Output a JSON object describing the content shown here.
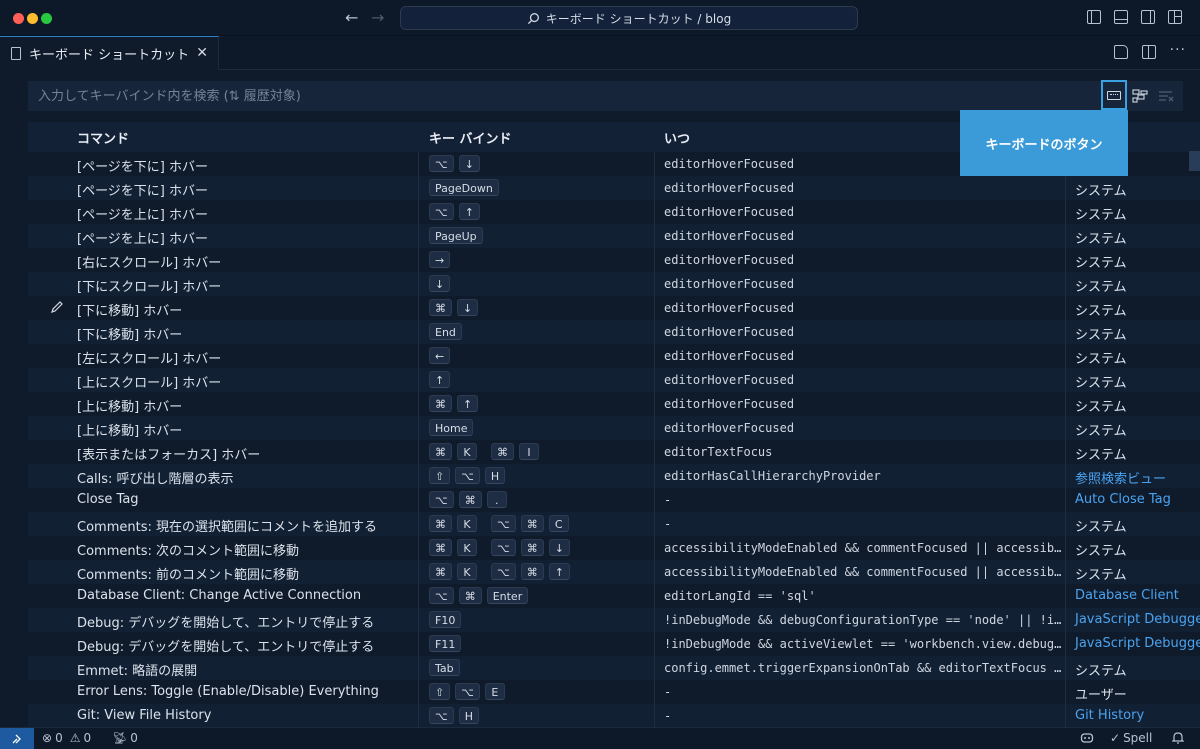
{
  "titlebar": {
    "search_text": "キーボード ショートカット / blog",
    "back": "←",
    "forward": "→"
  },
  "tab": {
    "label": "キーボード ショートカット",
    "close": "✕",
    "more": "···"
  },
  "search": {
    "placeholder": "入力してキーバインド内を検索 (⇅ 履歴対象)",
    "value": ""
  },
  "tooltip": "キーボードのボタン",
  "columns": {
    "command": "コマンド",
    "keybinding": "キー バインド",
    "when": "いつ",
    "source": ""
  },
  "rows": [
    {
      "cmd": "[ページを下に] ホバー",
      "keys": [
        "⌥",
        "↓"
      ],
      "when": "editorHoverFocused",
      "src": ""
    },
    {
      "cmd": "[ページを下に] ホバー",
      "keys": [
        "PageDown"
      ],
      "when": "editorHoverFocused",
      "src": "システム"
    },
    {
      "cmd": "[ページを上に] ホバー",
      "keys": [
        "⌥",
        "↑"
      ],
      "when": "editorHoverFocused",
      "src": "システム"
    },
    {
      "cmd": "[ページを上に] ホバー",
      "keys": [
        "PageUp"
      ],
      "when": "editorHoverFocused",
      "src": "システム"
    },
    {
      "cmd": "[右にスクロール] ホバー",
      "keys": [
        "→"
      ],
      "when": "editorHoverFocused",
      "src": "システム"
    },
    {
      "cmd": "[下にスクロール] ホバー",
      "keys": [
        "↓"
      ],
      "when": "editorHoverFocused",
      "src": "システム"
    },
    {
      "cmd": "[下に移動] ホバー",
      "keys": [
        "⌘",
        "↓"
      ],
      "when": "editorHoverFocused",
      "src": "システム",
      "edit": true
    },
    {
      "cmd": "[下に移動] ホバー",
      "keys": [
        "End"
      ],
      "when": "editorHoverFocused",
      "src": "システム"
    },
    {
      "cmd": "[左にスクロール] ホバー",
      "keys": [
        "←"
      ],
      "when": "editorHoverFocused",
      "src": "システム"
    },
    {
      "cmd": "[上にスクロール] ホバー",
      "keys": [
        "↑"
      ],
      "when": "editorHoverFocused",
      "src": "システム"
    },
    {
      "cmd": "[上に移動] ホバー",
      "keys": [
        "⌘",
        "↑"
      ],
      "when": "editorHoverFocused",
      "src": "システム"
    },
    {
      "cmd": "[上に移動] ホバー",
      "keys": [
        "Home"
      ],
      "when": "editorHoverFocused",
      "src": "システム"
    },
    {
      "cmd": "[表示またはフォーカス] ホバー",
      "keys": [
        "⌘",
        "K",
        "|",
        "⌘",
        "I"
      ],
      "when": "editorTextFocus",
      "src": "システム"
    },
    {
      "cmd": "Calls: 呼び出し階層の表示",
      "keys": [
        "⇧",
        "⌥",
        "H"
      ],
      "when": "editorHasCallHierarchyProvider",
      "src": "参照検索ビュー",
      "link": true
    },
    {
      "cmd": "Close Tag",
      "keys": [
        "⌥",
        "⌘",
        "."
      ],
      "when": "-",
      "src": "Auto Close Tag",
      "link": true
    },
    {
      "cmd": "Comments: 現在の選択範囲にコメントを追加する",
      "keys": [
        "⌘",
        "K",
        "|",
        "⌥",
        "⌘",
        "C"
      ],
      "when": "-",
      "src": "システム"
    },
    {
      "cmd": "Comments: 次のコメント範囲に移動",
      "keys": [
        "⌘",
        "K",
        "|",
        "⌥",
        "⌘",
        "↓"
      ],
      "when": "accessibilityModeEnabled && commentFocused || accessibilityModeEnabled",
      "src": "システム"
    },
    {
      "cmd": "Comments: 前のコメント範囲に移動",
      "keys": [
        "⌘",
        "K",
        "|",
        "⌥",
        "⌘",
        "↑"
      ],
      "when": "accessibilityModeEnabled && commentFocused || accessibilityModeEnabled",
      "src": "システム"
    },
    {
      "cmd": "Database Client: Change Active Connection",
      "keys": [
        "⌥",
        "⌘",
        "Enter"
      ],
      "when": "editorLangId == 'sql'",
      "src": "Database Client",
      "link": true
    },
    {
      "cmd": "Debug: デバッグを開始して、エントリで停止する",
      "keys": [
        "F10"
      ],
      "when": "!inDebugMode && debugConfigurationType == 'node' || !inDebugMode",
      "src": "JavaScript Debugger",
      "link": true
    },
    {
      "cmd": "Debug: デバッグを開始して、エントリで停止する",
      "keys": [
        "F11"
      ],
      "when": "!inDebugMode && activeViewlet == 'workbench.view.debug' && debug",
      "src": "JavaScript Debugger",
      "link": true
    },
    {
      "cmd": "Emmet: 略語の展開",
      "keys": [
        "Tab"
      ],
      "when": "config.emmet.triggerExpansionOnTab && editorTextFocus && !editor",
      "src": "システム"
    },
    {
      "cmd": "Error Lens: Toggle (Enable/Disable) Everything",
      "keys": [
        "⇧",
        "⌥",
        "E"
      ],
      "when": "-",
      "src": "ユーザー"
    },
    {
      "cmd": "Git: View File History",
      "keys": [
        "⌥",
        "H"
      ],
      "when": "-",
      "src": "Git History",
      "link": true
    }
  ],
  "statusbar": {
    "errors": "0",
    "warnings": "0",
    "ports": "0",
    "spell": "Spell"
  },
  "colors": {
    "accent": "#3a9bd8",
    "link": "#4aa3f0",
    "background": "#0f1b2b"
  }
}
